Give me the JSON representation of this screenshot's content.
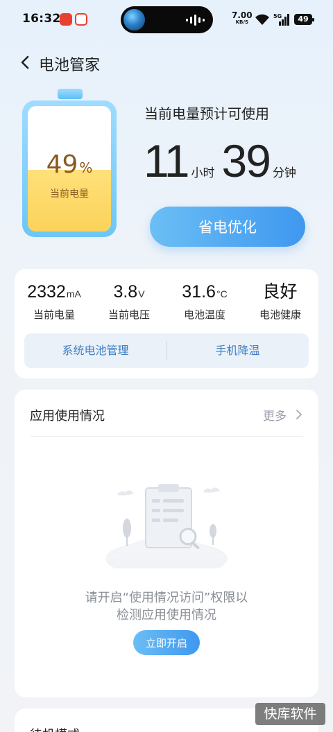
{
  "status_bar": {
    "time": "16:32",
    "net_speed": "7.00",
    "net_unit": "KB/S",
    "network_type": "5G",
    "battery_level": "49"
  },
  "header": {
    "title": "电池管家"
  },
  "battery": {
    "percent": "49",
    "percent_unit": "%",
    "label": "当前电量",
    "fill_fraction": 0.49
  },
  "estimate": {
    "label": "当前电量预计可使用",
    "hours": "11",
    "hours_unit": "小时",
    "minutes": "39",
    "minutes_unit": "分钟",
    "optimize_button": "省电优化"
  },
  "stats": [
    {
      "value": "2332",
      "unit": "mA",
      "label": "当前电量"
    },
    {
      "value": "3.8",
      "unit": "V",
      "label": "当前电压"
    },
    {
      "value": "31.6",
      "unit": "°C",
      "label": "电池温度"
    },
    {
      "value": "良好",
      "unit": "",
      "label": "电池健康"
    }
  ],
  "tools": {
    "battery_management": "系统电池管理",
    "phone_cooling": "手机降温"
  },
  "app_usage": {
    "title": "应用使用情况",
    "more": "更多",
    "permission_line1": "请开启“使用情况访问”权限以",
    "permission_line2": "检测应用使用情况",
    "enable_button": "立即开启"
  },
  "next_section": {
    "title": "待机模式"
  },
  "watermark": "快库软件",
  "colors": {
    "accent": "#3f98ef",
    "battery_fill": "#fbd35a",
    "battery_text": "#8a5a1e",
    "tool_text": "#3f7fc2"
  }
}
